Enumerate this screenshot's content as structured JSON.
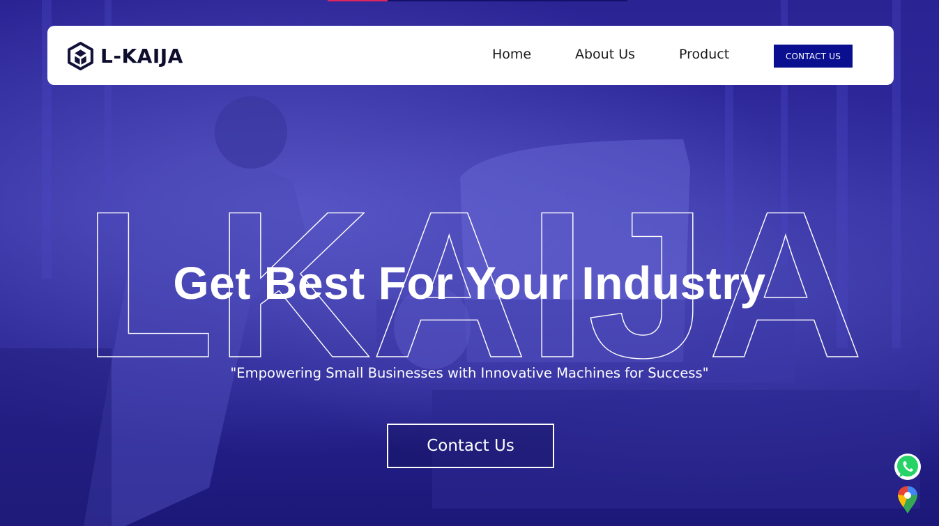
{
  "brand": {
    "name": "L-KAIJA",
    "logo_icon": "cube-logo-icon"
  },
  "nav": {
    "items": [
      {
        "label": "Home"
      },
      {
        "label": "About Us"
      },
      {
        "label": "Product"
      }
    ],
    "cta_label": "CONTACT US"
  },
  "hero": {
    "outline_word": "LKAIJA",
    "headline": "Get Best For Your Industry",
    "tagline": "\"Empowering Small Businesses with Innovative Machines for Success\"",
    "cta_label": "Contact Us"
  },
  "floating": {
    "whatsapp_icon": "whatsapp-icon",
    "maps_icon": "google-maps-icon"
  },
  "colors": {
    "overlay": "#2a2394",
    "nav_cta_bg": "#0a0f8f",
    "accent_pink": "#e0245e"
  }
}
